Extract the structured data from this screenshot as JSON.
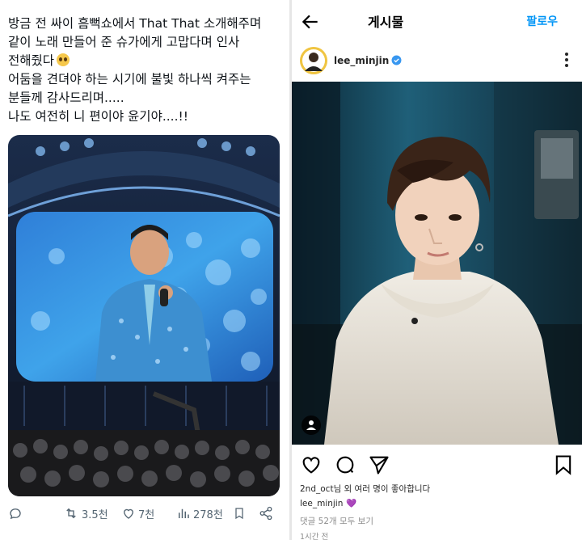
{
  "tweet": {
    "lines": [
      "방금 전 싸이 흠뻑쇼에서 That That 소개해주며",
      "같이 노래 만들어 준 슈가에게 고맙다며 인사",
      "전해줬다",
      "어둠을 견뎌야 하는 시기에 불빛 하나씩 켜주는",
      "분들께 감사드리며.....",
      "나도 여전히 니 편이야 윤기야....!!"
    ],
    "emoji": "pleading-face",
    "actions": {
      "retweets": "3.5천",
      "likes": "7천",
      "views": "278천"
    }
  },
  "instagram": {
    "title": "게시물",
    "follow": "팔로우",
    "username": "lee_minjin",
    "likes_text": "2nd_oct님 외 여러 명이 좋아합니다",
    "caption_user": "lee_minjin",
    "caption_emoji": "💜",
    "comments_link": "댓글 52개 모두 보기",
    "time": "1시간 전"
  },
  "colors": {
    "link_blue": "#0095f6",
    "verified_blue": "#3897f0",
    "muted": "#536471"
  }
}
